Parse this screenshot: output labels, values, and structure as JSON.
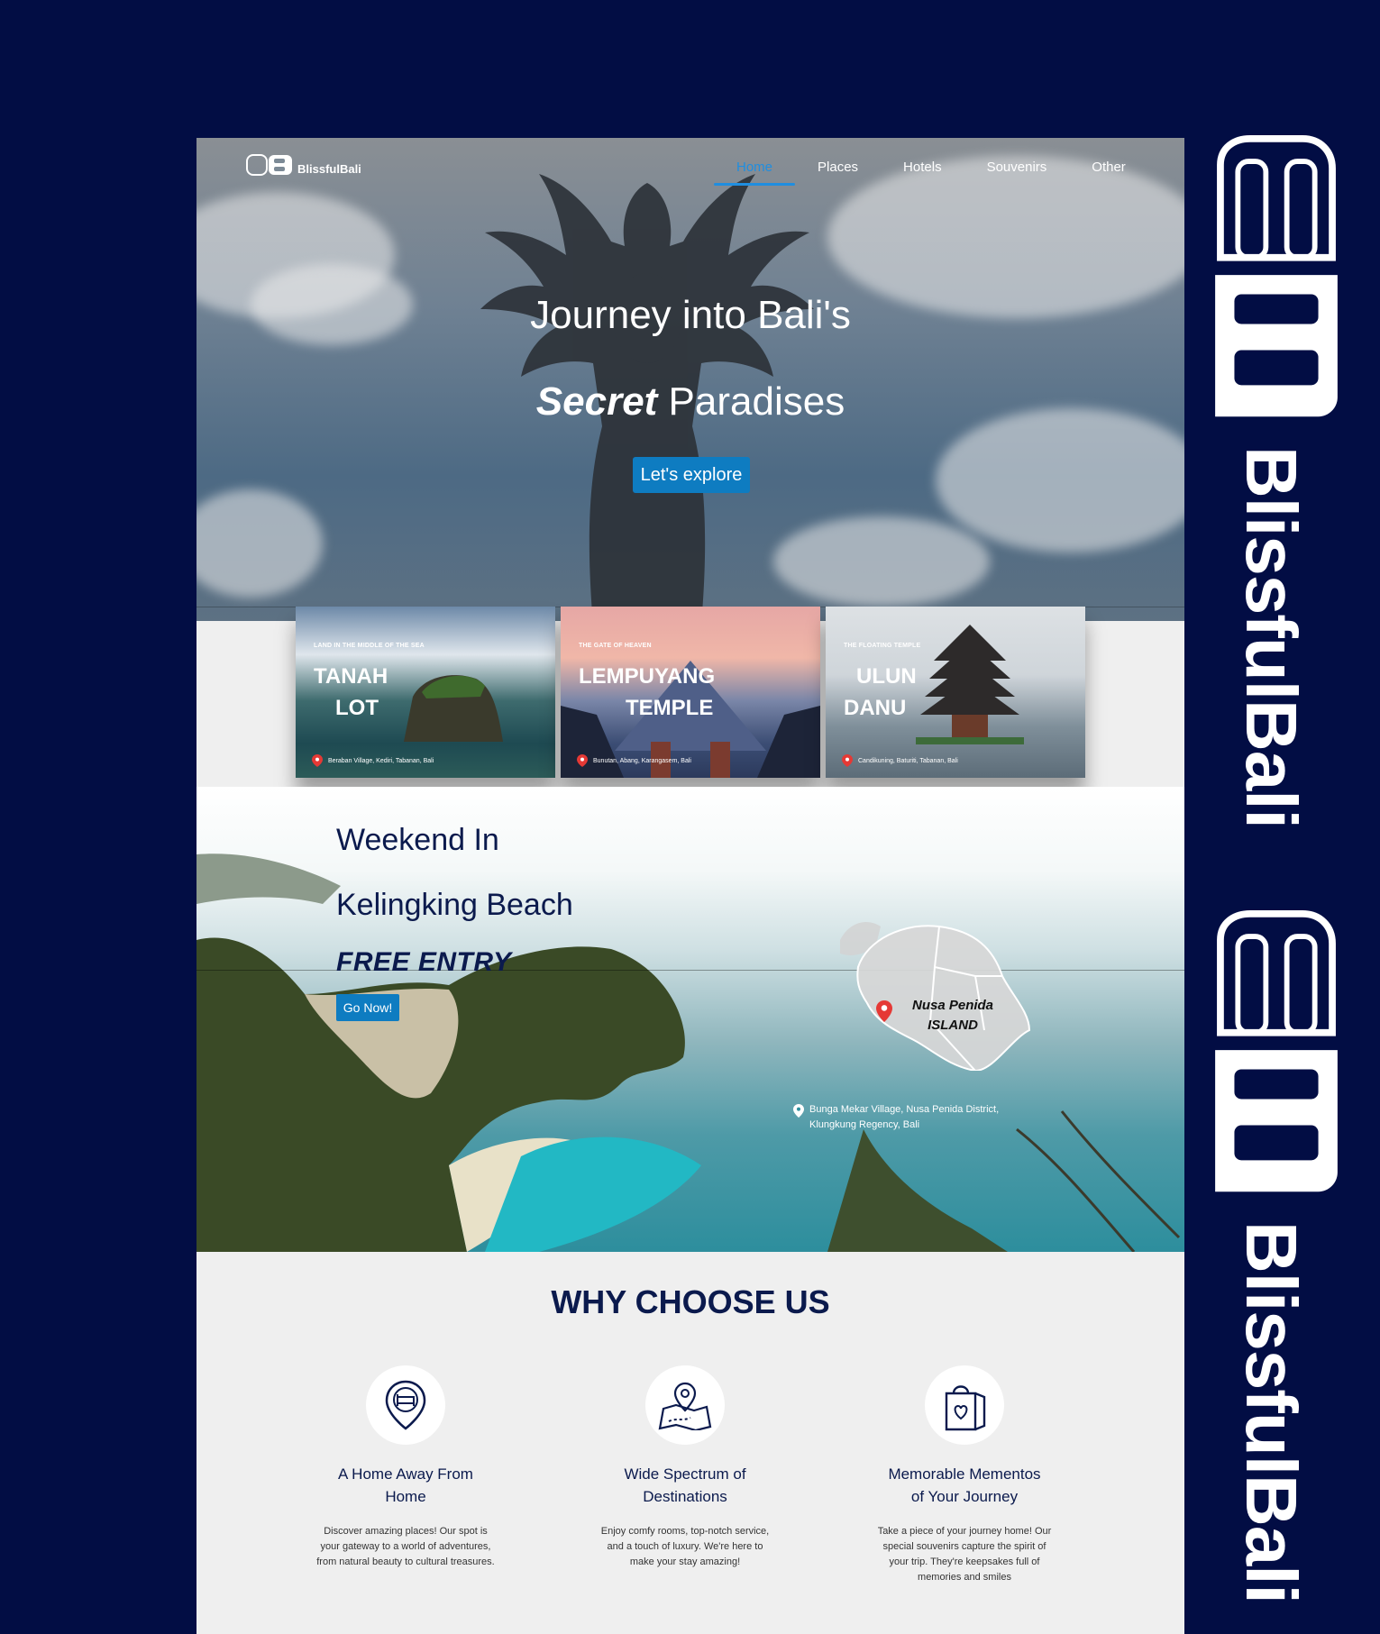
{
  "nav": {
    "logo_text": "BlissfulBali",
    "items": [
      {
        "label": "Home",
        "active": true
      },
      {
        "label": "Places",
        "active": false
      },
      {
        "label": "Hotels",
        "active": false
      },
      {
        "label": "Souvenirs",
        "active": false
      },
      {
        "label": "Other",
        "active": false
      }
    ]
  },
  "hero": {
    "title_line1": "Journey into Bali's",
    "title_bold": "Secret",
    "title_rest": " Paradises",
    "cta": "Let's explore"
  },
  "cards": [
    {
      "tag": "LAND IN THE MIDDLE OF THE SEA",
      "name_l1": "TANAH",
      "name_l2": "LOT",
      "location": "Beraban Village, Kediri, Tabanan, Bali"
    },
    {
      "tag": "THE GATE OF HEAVEN",
      "name_l1": "LEMPUYANG",
      "name_l2": "TEMPLE",
      "location": "Bunutan, Abang, Karangasem, Bali"
    },
    {
      "tag": "THE FLOATING TEMPLE",
      "name_l1": "ULUN",
      "name_l2": "DANU",
      "location": "Candikuning, Baturiti, Tabanan, Bali"
    }
  ],
  "beach": {
    "line1": "Weekend In",
    "line2": "Kelingking Beach",
    "line3": "FREE ENTRY",
    "cta": "Go Now!",
    "map_label_l1": "Nusa Penida",
    "map_label_l2": "ISLAND",
    "location_l1": "Bunga Mekar Village, Nusa Penida District,",
    "location_l2": "Klungkung Regency, Bali"
  },
  "why": {
    "title": "WHY CHOOSE US",
    "features": [
      {
        "icon": "hotel-pin-icon",
        "title_l1": "A Home Away From",
        "title_l2": "Home",
        "desc": "Discover amazing places! Our spot is your gateway to a world of adventures, from natural beauty to cultural treasures."
      },
      {
        "icon": "map-route-icon",
        "title_l1": "Wide Spectrum of",
        "title_l2": "Destinations",
        "desc": "Enjoy comfy rooms, top-notch service, and a touch of luxury. We're here to make your stay amazing!"
      },
      {
        "icon": "shopping-bag-icon",
        "title_l1": "Memorable Mementos",
        "title_l2": "of Your Journey",
        "desc": "Take a piece of your journey home! Our special souvenirs capture the spirit of your trip. They're keepsakes full of memories and smiles"
      }
    ]
  },
  "brand": {
    "word": "BlissfulBali"
  },
  "colors": {
    "background": "#020d44",
    "accent": "#0e7cc1",
    "navy": "#0b1a4d"
  }
}
